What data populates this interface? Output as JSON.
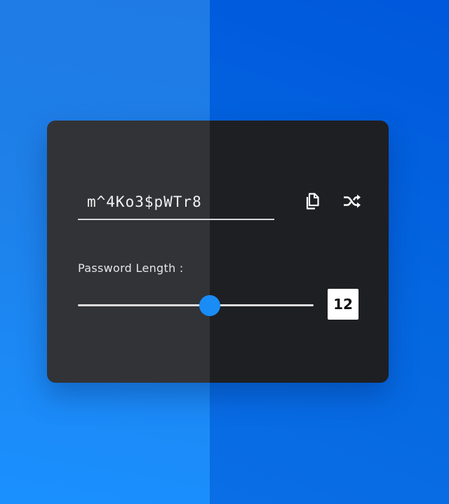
{
  "generator": {
    "password": "m^4Ko3$pWTr8",
    "length_label": "Password Length :",
    "length_value": "12",
    "slider_fraction": 0.56,
    "copy_icon": "copy-icon",
    "shuffle_icon": "shuffle-icon"
  },
  "colors": {
    "accent": "#1a8cf5",
    "background_left": "#1e80e8",
    "background_right": "#0467e0",
    "card_left": "#323336",
    "card_right": "#1e1f22"
  }
}
